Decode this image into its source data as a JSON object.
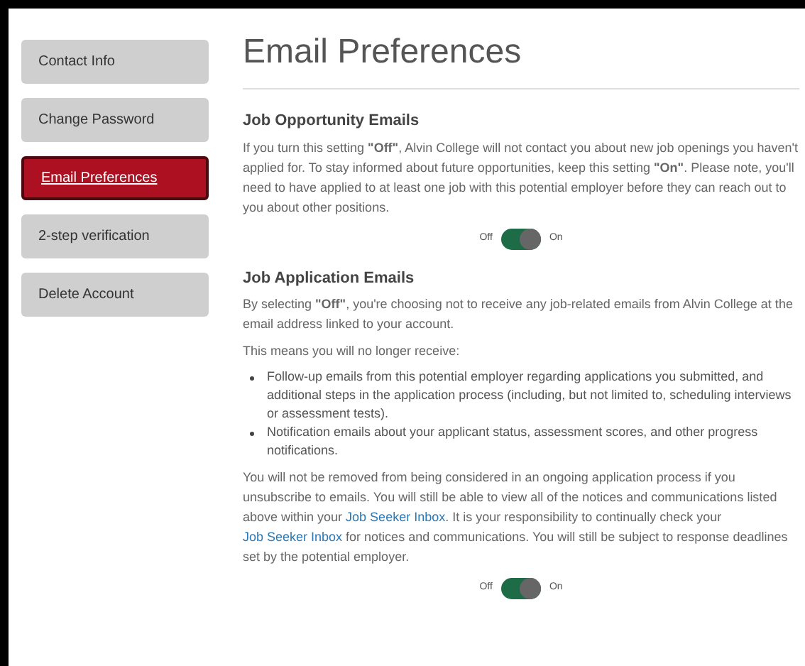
{
  "sidebar": {
    "items": [
      {
        "label": "Contact Info",
        "selected": false
      },
      {
        "label": "Change Password",
        "selected": false
      },
      {
        "label": "Email Preferences",
        "selected": true
      },
      {
        "label": "2-step verification",
        "selected": false
      },
      {
        "label": "Delete Account",
        "selected": false
      }
    ]
  },
  "title": "Email Preferences",
  "sections": [
    {
      "heading": "Job Opportunity Emails",
      "blocks": [
        {
          "kind": "paragraph",
          "parts": [
            {
              "kind": "text",
              "text": "If you turn this setting **\"Off\"**, Alvin College will not contact you about new job openings you haven't applied for. To stay informed about future opportunities, keep this setting **\"On\"**. Please note, you'll need to have applied to at least one job with this potential employer before they can reach out to you about other positions."
            }
          ]
        }
      ],
      "toggle": {
        "off_label": "Off",
        "on_label": "On",
        "on": true
      }
    },
    {
      "heading": "Job Application Emails",
      "blocks": [
        {
          "kind": "paragraph",
          "parts": [
            {
              "kind": "text",
              "text": "By selecting **\"Off\"**, you're choosing not to receive any job-related emails from Alvin College at the email address linked to your account."
            }
          ]
        },
        {
          "kind": "paragraph",
          "parts": [
            {
              "kind": "text",
              "text": "This means you will no longer receive:"
            }
          ]
        },
        {
          "kind": "list",
          "items": [
            "Follow-up emails from this potential employer regarding applications you submitted, and additional steps in the application process (including, but not limited to, scheduling interviews or assessment tests).",
            "Notification emails about your applicant status, assessment scores, and other progress notifications."
          ]
        },
        {
          "kind": "paragraph",
          "parts": [
            {
              "kind": "text",
              "text": "You will not be removed from being considered in an ongoing application process if you unsubscribe to emails. You will still be able to view all of the notices and communications listed above within your "
            },
            {
              "kind": "link",
              "text": "Job Seeker Inbox"
            },
            {
              "kind": "text",
              "text": ". It is your responsibility to continually check your "
            },
            {
              "kind": "link",
              "text": "Job Seeker Inbox"
            },
            {
              "kind": "text",
              "text": " for notices and communications. You will still be subject to response deadlines set by the potential employer."
            }
          ]
        }
      ],
      "toggle": {
        "off_label": "Off",
        "on_label": "On",
        "on": true
      }
    }
  ]
}
